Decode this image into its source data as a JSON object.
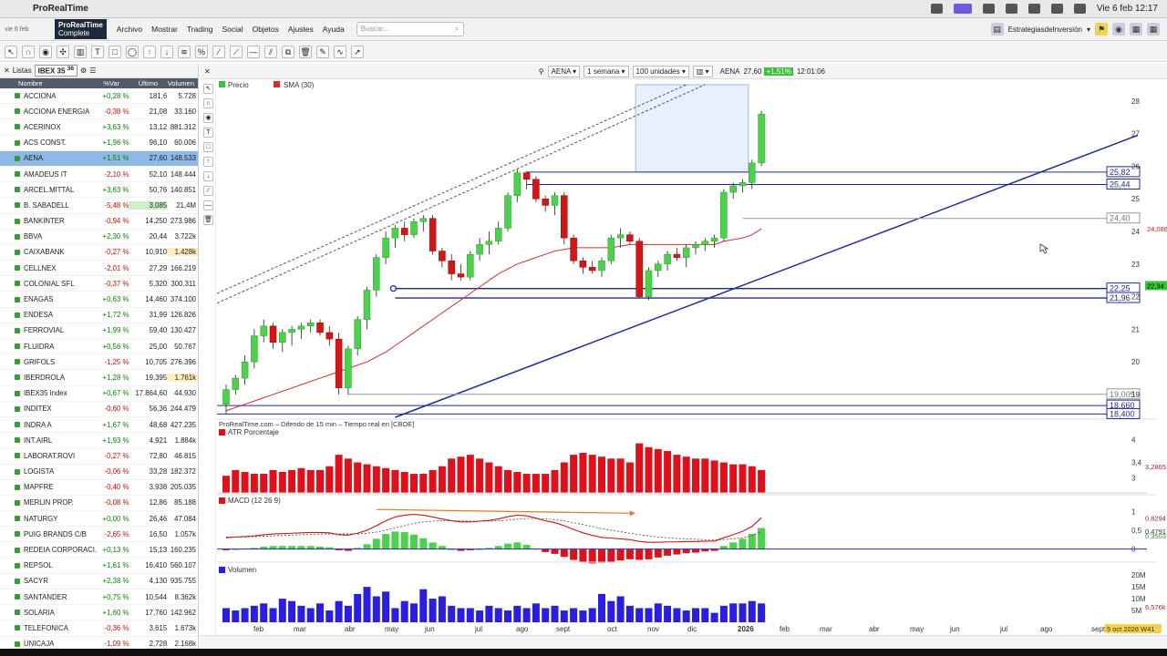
{
  "mac": {
    "app_name": "ProRealTime",
    "clock": "Vie 6 feb 12:17"
  },
  "menubar": {
    "date_line1": "vie 6 feb",
    "logo_line1": "ProRealTime",
    "logo_line2": "Complete",
    "items": [
      "Archivo",
      "Mostrar",
      "Trading",
      "Social",
      "Objetos",
      "Ajustes",
      "Ayuda"
    ],
    "search_placeholder": "Buscar...",
    "strategy_label": "EstrategiasdeInversión"
  },
  "watchlist": {
    "tab_label": "Listas",
    "selected_list": "IBEX 35",
    "count": "36",
    "col_name": "Nombre",
    "col_var": "%Var",
    "col_last": "Último",
    "col_vol": "Volumen",
    "rows": [
      {
        "name": "ACCIONA",
        "var": "+0,28 %",
        "last": "181,6",
        "vol": "5.728",
        "dir": "pos"
      },
      {
        "name": "ACCIONA ENERGIA",
        "var": "-0,38 %",
        "last": "21,08",
        "vol": "33.160",
        "dir": "neg"
      },
      {
        "name": "ACERINOX",
        "var": "+3,63 %",
        "last": "13,12",
        "vol": "881.312",
        "dir": "pos"
      },
      {
        "name": "ACS CONST.",
        "var": "+1,96 %",
        "last": "96,10",
        "vol": "60.006",
        "dir": "pos"
      },
      {
        "name": "AENA",
        "var": "+1,51 %",
        "last": "27,60",
        "vol": "148.533",
        "dir": "pos",
        "sel": true
      },
      {
        "name": "AMADEUS IT",
        "var": "-2,10 %",
        "last": "52,10",
        "vol": "148.444",
        "dir": "neg"
      },
      {
        "name": "ARCEL.MITTAL",
        "var": "+3,63 %",
        "last": "50,76",
        "vol": "140.851",
        "dir": "pos"
      },
      {
        "name": "B. SABADELL",
        "var": "-5,48 %",
        "last": "3,085",
        "vol": "21,4M",
        "dir": "neg",
        "hl": "up"
      },
      {
        "name": "BANKINTER",
        "var": "-0,94 %",
        "last": "14,250",
        "vol": "273.986",
        "dir": "neg"
      },
      {
        "name": "BBVA",
        "var": "+2,30 %",
        "last": "20,44",
        "vol": "3.722k",
        "dir": "pos"
      },
      {
        "name": "CAIXABANK",
        "var": "-0,27 %",
        "last": "10,910",
        "vol": "1.428k",
        "dir": "neg",
        "vhl": true
      },
      {
        "name": "CELLNEX",
        "var": "-2,01 %",
        "last": "27,29",
        "vol": "166.219",
        "dir": "neg"
      },
      {
        "name": "COLONIAL SFL",
        "var": "-0,37 %",
        "last": "5,320",
        "vol": "300.311",
        "dir": "neg"
      },
      {
        "name": "ENAGAS",
        "var": "+0,63 %",
        "last": "14,460",
        "vol": "374.100",
        "dir": "pos"
      },
      {
        "name": "ENDESA",
        "var": "+1,72 %",
        "last": "31,99",
        "vol": "126.826",
        "dir": "pos"
      },
      {
        "name": "FERROVIAL",
        "var": "+1,99 %",
        "last": "59,40",
        "vol": "130.427",
        "dir": "pos"
      },
      {
        "name": "FLUIDRA",
        "var": "+0,56 %",
        "last": "25,00",
        "vol": "50.767",
        "dir": "pos"
      },
      {
        "name": "GRIFOLS",
        "var": "-1,25 %",
        "last": "10,705",
        "vol": "276.396",
        "dir": "neg"
      },
      {
        "name": "IBERDROLA",
        "var": "+1,28 %",
        "last": "19,395",
        "vol": "1.761k",
        "dir": "pos",
        "vhl": true
      },
      {
        "name": "IBEX35 Index",
        "var": "+0,67 %",
        "last": "17.864,60",
        "vol": "44.930",
        "dir": "pos"
      },
      {
        "name": "INDITEX",
        "var": "-0,60 %",
        "last": "56,36",
        "vol": "244.479",
        "dir": "neg"
      },
      {
        "name": "INDRA A",
        "var": "+1,67 %",
        "last": "48,68",
        "vol": "427.235",
        "dir": "pos"
      },
      {
        "name": "INT.AIRL",
        "var": "+1,93 %",
        "last": "4,921",
        "vol": "1.884k",
        "dir": "pos"
      },
      {
        "name": "LABORAT.ROVI",
        "var": "-0,27 %",
        "last": "72,80",
        "vol": "46.815",
        "dir": "neg"
      },
      {
        "name": "LOGISTA",
        "var": "-0,06 %",
        "last": "33,28",
        "vol": "182.372",
        "dir": "neg"
      },
      {
        "name": "MAPFRE",
        "var": "-0,40 %",
        "last": "3,938",
        "vol": "205.035",
        "dir": "neg"
      },
      {
        "name": "MERLIN PROP.",
        "var": "-0,08 %",
        "last": "12,86",
        "vol": "85.188",
        "dir": "neg"
      },
      {
        "name": "NATURGY",
        "var": "+0,00 %",
        "last": "26,46",
        "vol": "47.084",
        "dir": "pos"
      },
      {
        "name": "PUIG BRANDS C/B",
        "var": "-2,65 %",
        "last": "16,50",
        "vol": "1.057k",
        "dir": "neg"
      },
      {
        "name": "REDEIA CORPORACI...",
        "var": "+0,13 %",
        "last": "15,13",
        "vol": "160.235",
        "dir": "pos"
      },
      {
        "name": "REPSOL",
        "var": "+1,61 %",
        "last": "16,410",
        "vol": "560.107",
        "dir": "pos"
      },
      {
        "name": "SACYR",
        "var": "+2,38 %",
        "last": "4,130",
        "vol": "935.755",
        "dir": "pos"
      },
      {
        "name": "SANTANDER",
        "var": "+0,75 %",
        "last": "10,544",
        "vol": "8.362k",
        "dir": "pos"
      },
      {
        "name": "SOLARIA",
        "var": "+1,60 %",
        "last": "17,760",
        "vol": "142.962",
        "dir": "pos"
      },
      {
        "name": "TELEFONICA",
        "var": "-0,36 %",
        "last": "3,615",
        "vol": "1.673k",
        "dir": "neg"
      },
      {
        "name": "UNICAJA",
        "var": "-1,09 %",
        "last": "2,728",
        "vol": "2.168k",
        "dir": "neg"
      }
    ]
  },
  "chart_header": {
    "ticker": "AENA",
    "period": "1 semana",
    "units": "100 unidades",
    "quote_name": "AENA",
    "quote_price": "27,60",
    "quote_change": "+1,51%",
    "quote_time": "12:01:06"
  },
  "chart_data": {
    "type": "candlestick",
    "price_panel_label": "Precio",
    "sma_label": "SMA (30)",
    "source_note": "ProRealTime.com – Diferido de 15 min – Tiempo real en [CBOE]",
    "price_ylim": [
      18.3,
      28.5
    ],
    "price_ticks": [
      "28",
      "27",
      "26",
      "25",
      "24",
      "23",
      "22",
      "21",
      "20",
      "19"
    ],
    "levels": [
      {
        "label": "25,82",
        "value": 25.82
      },
      {
        "label": "25,44",
        "value": 25.44
      },
      {
        "label": "24,40",
        "value": 24.4
      },
      {
        "label": "22,25",
        "value": 22.25
      },
      {
        "label": "21,96",
        "value": 21.96
      },
      {
        "label": "19,005",
        "value": 19.005
      },
      {
        "label": "18,660",
        "value": 18.66
      },
      {
        "label": "18,400",
        "value": 18.4
      }
    ],
    "price_markers": [
      {
        "label": "24,086",
        "value": 24.086
      },
      {
        "label": "22,34",
        "value": 22.34
      }
    ],
    "candles": [
      [
        18.7,
        19.3,
        18.4,
        19.15
      ],
      [
        19.15,
        19.6,
        19.0,
        19.5
      ],
      [
        19.5,
        20.2,
        19.3,
        20.0
      ],
      [
        20.0,
        21.0,
        19.8,
        20.8
      ],
      [
        20.8,
        21.3,
        20.6,
        21.1
      ],
      [
        21.1,
        21.2,
        20.4,
        20.6
      ],
      [
        20.6,
        21.0,
        20.3,
        20.9
      ],
      [
        20.9,
        21.1,
        20.5,
        21.0
      ],
      [
        21.0,
        21.2,
        20.7,
        21.1
      ],
      [
        21.1,
        21.3,
        20.9,
        21.2
      ],
      [
        21.2,
        21.3,
        20.8,
        20.9
      ],
      [
        20.9,
        21.1,
        20.5,
        20.7
      ],
      [
        20.7,
        20.9,
        19.0,
        19.2
      ],
      [
        19.2,
        20.5,
        19.0,
        20.4
      ],
      [
        20.4,
        21.4,
        20.2,
        21.3
      ],
      [
        21.3,
        22.3,
        21.0,
        22.2
      ],
      [
        22.2,
        23.3,
        22.0,
        23.2
      ],
      [
        23.2,
        24.0,
        23.0,
        23.8
      ],
      [
        23.8,
        24.2,
        23.5,
        24.1
      ],
      [
        24.1,
        24.3,
        23.7,
        23.9
      ],
      [
        23.9,
        24.4,
        23.8,
        24.3
      ],
      [
        24.3,
        24.5,
        24.0,
        24.4
      ],
      [
        24.4,
        24.5,
        23.3,
        23.4
      ],
      [
        23.4,
        23.5,
        22.9,
        23.1
      ],
      [
        23.1,
        23.3,
        22.5,
        22.7
      ],
      [
        22.7,
        23.0,
        22.5,
        22.6
      ],
      [
        22.6,
        23.4,
        22.5,
        23.3
      ],
      [
        23.3,
        23.8,
        23.1,
        23.6
      ],
      [
        23.6,
        24.0,
        23.3,
        23.7
      ],
      [
        23.7,
        24.3,
        23.6,
        24.1
      ],
      [
        24.1,
        25.2,
        24.0,
        25.1
      ],
      [
        25.1,
        25.9,
        24.9,
        25.8
      ],
      [
        25.8,
        25.85,
        25.3,
        25.6
      ],
      [
        25.6,
        25.7,
        24.9,
        25.0
      ],
      [
        25.0,
        25.1,
        24.6,
        24.8
      ],
      [
        24.8,
        25.2,
        24.5,
        25.1
      ],
      [
        25.1,
        25.2,
        23.6,
        23.8
      ],
      [
        23.8,
        23.9,
        23.0,
        23.1
      ],
      [
        23.1,
        23.2,
        22.7,
        22.9
      ],
      [
        22.9,
        23.1,
        22.7,
        22.8
      ],
      [
        22.8,
        23.2,
        22.6,
        23.1
      ],
      [
        23.1,
        23.9,
        23.0,
        23.8
      ],
      [
        23.8,
        24.1,
        23.5,
        23.9
      ],
      [
        23.9,
        24.0,
        23.6,
        23.7
      ],
      [
        23.7,
        23.8,
        21.95,
        22.0
      ],
      [
        22.0,
        22.9,
        21.9,
        22.8
      ],
      [
        22.8,
        23.1,
        22.6,
        23.0
      ],
      [
        23.0,
        23.4,
        22.8,
        23.3
      ],
      [
        23.3,
        23.5,
        23.1,
        23.2
      ],
      [
        23.2,
        23.6,
        22.9,
        23.5
      ],
      [
        23.5,
        23.7,
        23.3,
        23.6
      ],
      [
        23.6,
        23.8,
        23.4,
        23.7
      ],
      [
        23.7,
        23.9,
        23.5,
        23.8
      ],
      [
        23.8,
        25.3,
        23.7,
        25.2
      ],
      [
        25.2,
        25.5,
        25.0,
        25.4
      ],
      [
        25.4,
        25.6,
        25.2,
        25.5
      ],
      [
        25.5,
        26.2,
        25.3,
        26.1
      ],
      [
        26.1,
        27.7,
        26.0,
        27.6
      ]
    ],
    "sma": [
      18.5,
      18.6,
      18.7,
      18.8,
      18.9,
      19.0,
      19.1,
      19.2,
      19.3,
      19.4,
      19.5,
      19.6,
      19.7,
      19.8,
      19.9,
      20.0,
      20.15,
      20.3,
      20.5,
      20.7,
      20.9,
      21.1,
      21.3,
      21.5,
      21.7,
      21.9,
      22.1,
      22.3,
      22.5,
      22.7,
      22.85,
      23.0,
      23.1,
      23.2,
      23.3,
      23.4,
      23.45,
      23.5,
      23.5,
      23.5,
      23.5,
      23.5,
      23.55,
      23.6,
      23.6,
      23.6,
      23.6,
      23.6,
      23.6,
      23.6,
      23.6,
      23.6,
      23.6,
      23.7,
      23.75,
      23.8,
      23.9,
      24.08
    ],
    "x_labels": [
      "feb",
      "mar",
      "abr",
      "may",
      "jun",
      "jul",
      "ago",
      "sept",
      "oct",
      "nov",
      "dic",
      "2026",
      "feb",
      "mar",
      "abr",
      "may",
      "jun",
      "jul",
      "ago",
      "sept"
    ],
    "x_footer": "5 oct 2026 W41",
    "atr": {
      "label": "ATR Porcentaje",
      "ylim": [
        2.6,
        4.2
      ],
      "ticks": [
        "4",
        "3,4",
        "3"
      ],
      "marker": "3,2865",
      "values": [
        3.05,
        3.2,
        3.15,
        3.1,
        3.1,
        3.2,
        3.15,
        3.2,
        3.25,
        3.2,
        3.2,
        3.3,
        3.6,
        3.5,
        3.4,
        3.35,
        3.3,
        3.25,
        3.2,
        3.15,
        3.1,
        3.1,
        3.2,
        3.3,
        3.5,
        3.55,
        3.6,
        3.5,
        3.4,
        3.3,
        3.2,
        3.15,
        3.1,
        3.1,
        3.1,
        3.2,
        3.4,
        3.6,
        3.65,
        3.6,
        3.55,
        3.5,
        3.5,
        3.4,
        3.9,
        3.8,
        3.75,
        3.7,
        3.6,
        3.55,
        3.5,
        3.5,
        3.45,
        3.4,
        3.35,
        3.35,
        3.3,
        3.2
      ]
    },
    "macd": {
      "label": "MACD (12 26 9)",
      "ylim": [
        -0.3,
        1.2
      ],
      "ticks": [
        "1",
        "0,5",
        "0"
      ],
      "markers": [
        "0,8294",
        "0,4791",
        "0,3503"
      ],
      "macd": [
        0.3,
        0.32,
        0.33,
        0.35,
        0.38,
        0.4,
        0.41,
        0.42,
        0.43,
        0.44,
        0.44,
        0.43,
        0.38,
        0.37,
        0.42,
        0.5,
        0.62,
        0.75,
        0.85,
        0.9,
        0.92,
        0.9,
        0.85,
        0.8,
        0.75,
        0.72,
        0.72,
        0.74,
        0.76,
        0.8,
        0.86,
        0.9,
        0.88,
        0.82,
        0.75,
        0.7,
        0.62,
        0.52,
        0.43,
        0.36,
        0.31,
        0.29,
        0.27,
        0.25,
        0.2,
        0.18,
        0.18,
        0.19,
        0.19,
        0.2,
        0.2,
        0.21,
        0.21,
        0.3,
        0.38,
        0.47,
        0.6,
        0.83
      ],
      "signal": [
        0.32,
        0.32,
        0.32,
        0.33,
        0.34,
        0.35,
        0.36,
        0.37,
        0.38,
        0.39,
        0.4,
        0.4,
        0.4,
        0.4,
        0.4,
        0.42,
        0.45,
        0.5,
        0.56,
        0.62,
        0.68,
        0.72,
        0.74,
        0.75,
        0.75,
        0.75,
        0.74,
        0.74,
        0.74,
        0.75,
        0.77,
        0.79,
        0.81,
        0.81,
        0.8,
        0.78,
        0.75,
        0.7,
        0.65,
        0.6,
        0.54,
        0.5,
        0.46,
        0.42,
        0.38,
        0.35,
        0.32,
        0.3,
        0.28,
        0.27,
        0.26,
        0.25,
        0.24,
        0.25,
        0.27,
        0.3,
        0.35,
        0.48
      ]
    },
    "volume": {
      "label": "Volumen",
      "ylim": [
        0,
        22
      ],
      "ticks": [
        "20M",
        "15M",
        "10M",
        "5M"
      ],
      "marker": "6,576k",
      "values": [
        6,
        5,
        6,
        7,
        8,
        6,
        10,
        9,
        7,
        6,
        8,
        5,
        9,
        7,
        12,
        15,
        11,
        13,
        6,
        9,
        8,
        14,
        10,
        11,
        7,
        6,
        6,
        5,
        7,
        6,
        5,
        7,
        6,
        8,
        6,
        7,
        5,
        6,
        5,
        6,
        12,
        9,
        11,
        7,
        6,
        6,
        8,
        7,
        6,
        5,
        6,
        6,
        4,
        7,
        8,
        8,
        9,
        8
      ]
    }
  }
}
